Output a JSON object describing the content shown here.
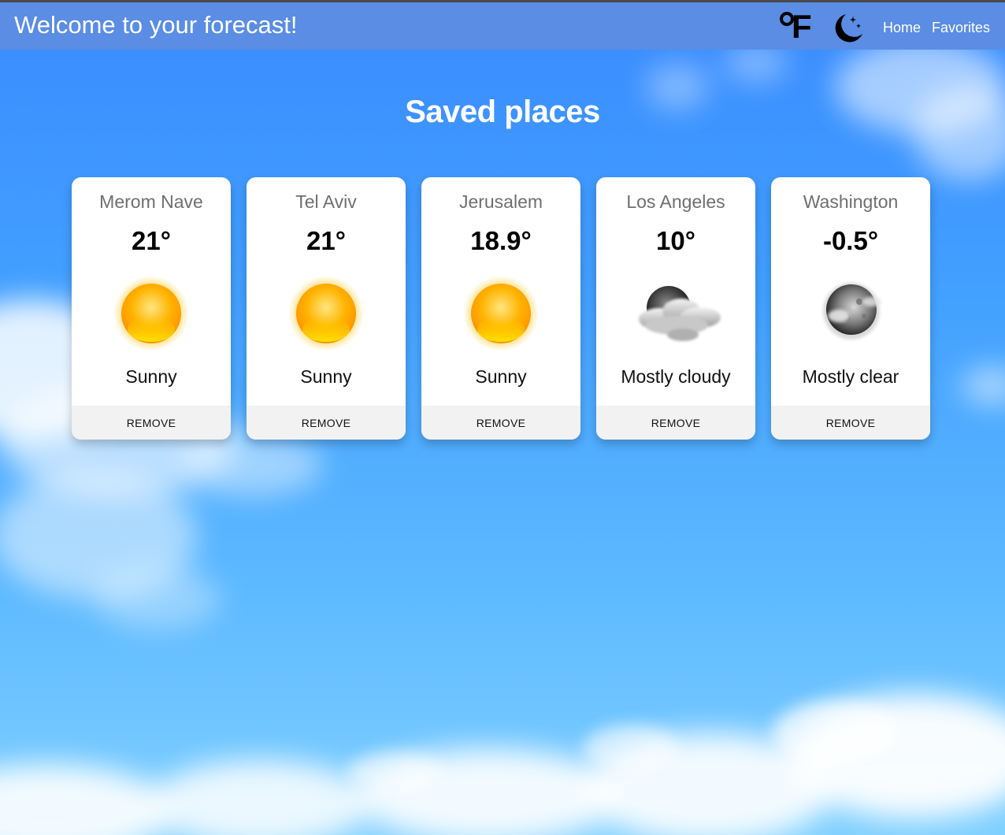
{
  "header": {
    "title": "Welcome to your forecast!",
    "unit_toggle_label": "°F",
    "unit_toggle_icon": "fahrenheit-icon",
    "theme_toggle_icon": "moon-stars-icon",
    "nav": {
      "home": "Home",
      "favorites": "Favorites"
    },
    "bar_color": "#5a8de3"
  },
  "main": {
    "heading": "Saved places",
    "cards": [
      {
        "city": "Merom Nave",
        "temp": "21°",
        "condition": "Sunny",
        "icon": "sun-icon",
        "remove_label": "REMOVE"
      },
      {
        "city": "Tel Aviv",
        "temp": "21°",
        "condition": "Sunny",
        "icon": "sun-icon",
        "remove_label": "REMOVE"
      },
      {
        "city": "Jerusalem",
        "temp": "18.9°",
        "condition": "Sunny",
        "icon": "sun-icon",
        "remove_label": "REMOVE"
      },
      {
        "city": "Los Angeles",
        "temp": "10°",
        "condition": "Mostly cloudy",
        "icon": "moon-cloud-icon",
        "remove_label": "REMOVE"
      },
      {
        "city": "Washington",
        "temp": "-0.5°",
        "condition": "Mostly clear",
        "icon": "moon-small-cloud-icon",
        "remove_label": "REMOVE"
      }
    ]
  },
  "colors": {
    "sky_top": "#3a8bff",
    "sky_bottom": "#7fd0ff",
    "card_bg": "#ffffff",
    "button_bg": "#f2f2f2"
  }
}
